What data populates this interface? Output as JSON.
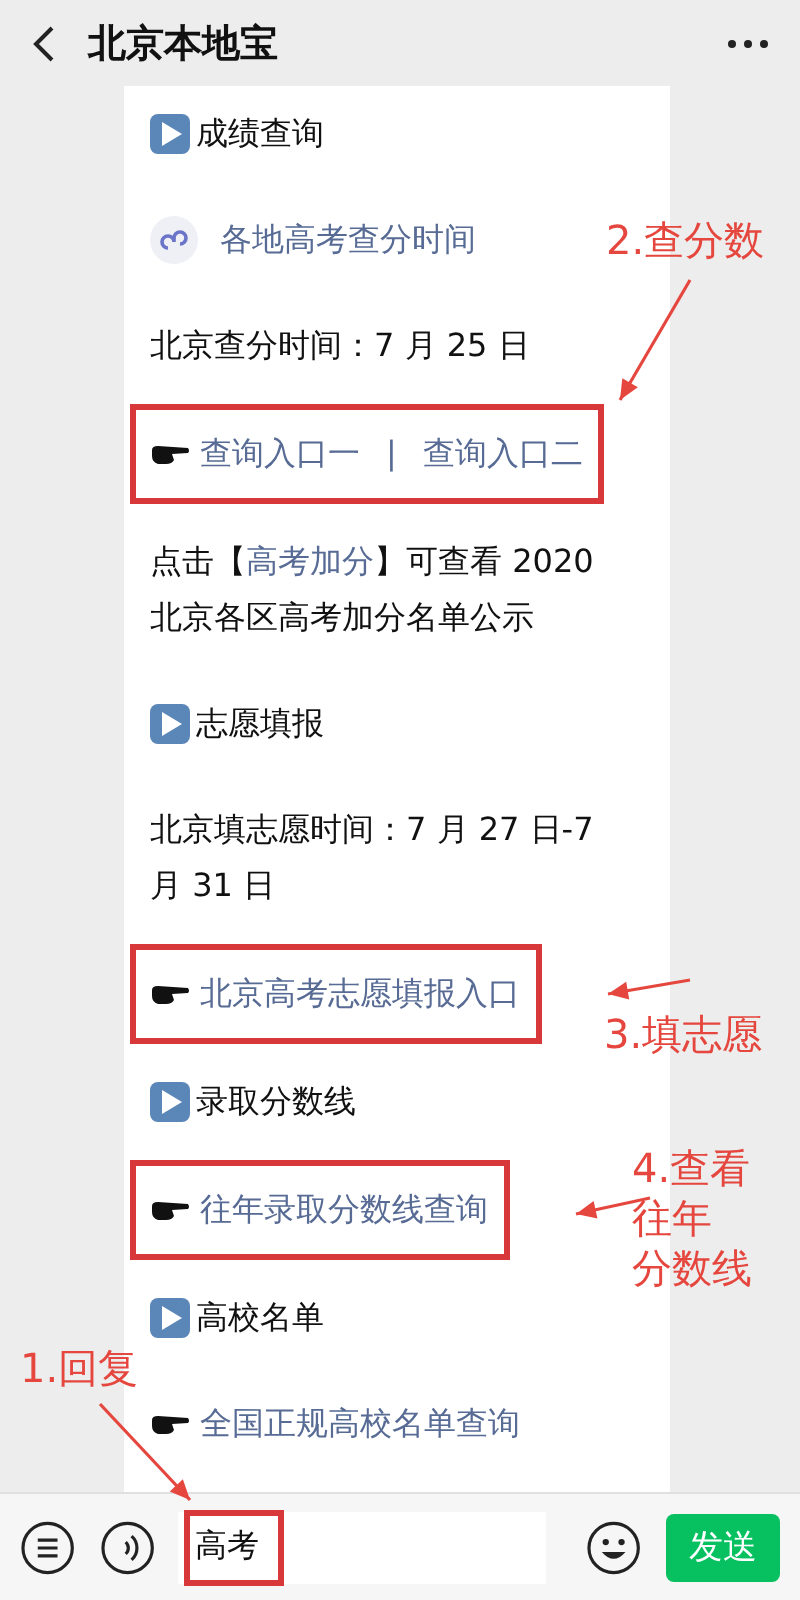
{
  "header": {
    "title": "北京本地宝"
  },
  "blocks": [
    {
      "kind": "heading",
      "text": "成绩查询"
    },
    {
      "kind": "miniprogram",
      "text": "各地高考查分时间"
    },
    {
      "kind": "paragraph",
      "text": "北京查分时间：7 月 25 日"
    },
    {
      "kind": "links",
      "highlighted": true,
      "links": [
        "查询入口一",
        "查询入口二"
      ],
      "separator": "|"
    },
    {
      "kind": "rich",
      "before": "点击【",
      "link": "高考加分",
      "after": "】可查看 2020 北京各区高考加分名单公示"
    },
    {
      "kind": "heading",
      "text": "志愿填报"
    },
    {
      "kind": "paragraph",
      "text": "北京填志愿时间：7 月 27 日-7 月 31 日"
    },
    {
      "kind": "links",
      "highlighted": true,
      "links": [
        "北京高考志愿填报入口"
      ]
    },
    {
      "kind": "heading",
      "text": "录取分数线"
    },
    {
      "kind": "links",
      "highlighted": true,
      "links": [
        "往年录取分数线查询"
      ]
    },
    {
      "kind": "heading",
      "text": "高校名单"
    },
    {
      "kind": "links",
      "highlighted": false,
      "links": [
        "全国正规高校名单查询"
      ]
    }
  ],
  "annotations": [
    {
      "lines": [
        "2.查分数"
      ]
    },
    {
      "lines": [
        "3.填志愿"
      ]
    },
    {
      "lines": [
        "4.查看",
        "往年",
        "分数线"
      ]
    },
    {
      "lines": [
        "1.回复"
      ]
    }
  ],
  "input": {
    "value": "高考",
    "highlighted": true
  },
  "send_button": "发送"
}
